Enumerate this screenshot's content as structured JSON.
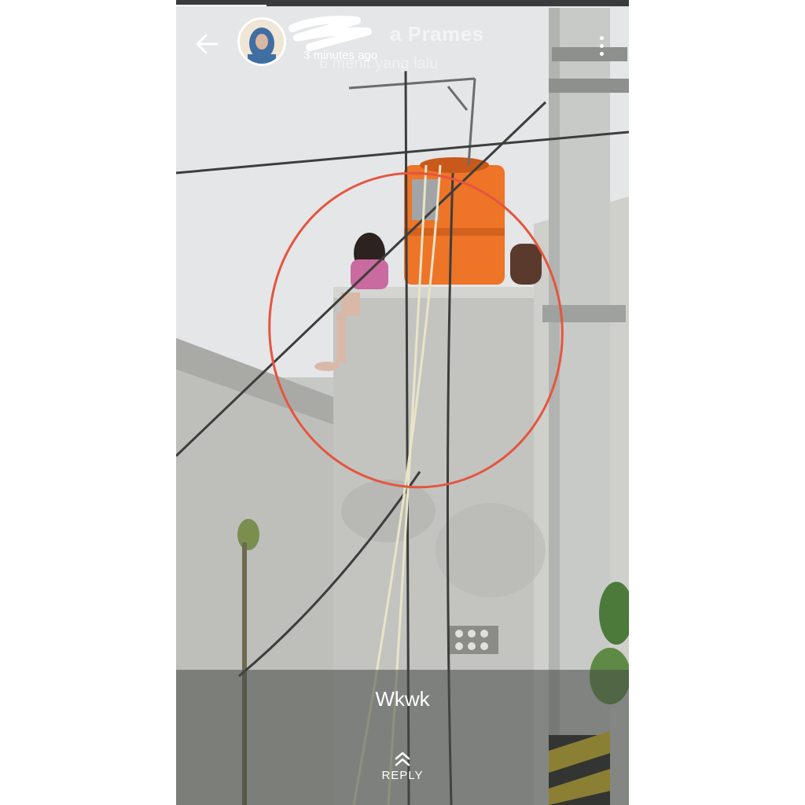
{
  "header": {
    "name_partial": "a Prames",
    "timestamp": "3 minutes ago",
    "timestamp_ghost": "6 menit yang lalu",
    "back_icon": "arrow-left-icon",
    "menu_icon": "more-vertical-icon"
  },
  "story": {
    "caption": "Wkwk",
    "reply_label": "REPLY",
    "reply_icon": "chevron-up-icon",
    "progress": 0.2
  },
  "colors": {
    "circle_annotation": "#e5553f",
    "water_tank": "#f07a2a"
  }
}
